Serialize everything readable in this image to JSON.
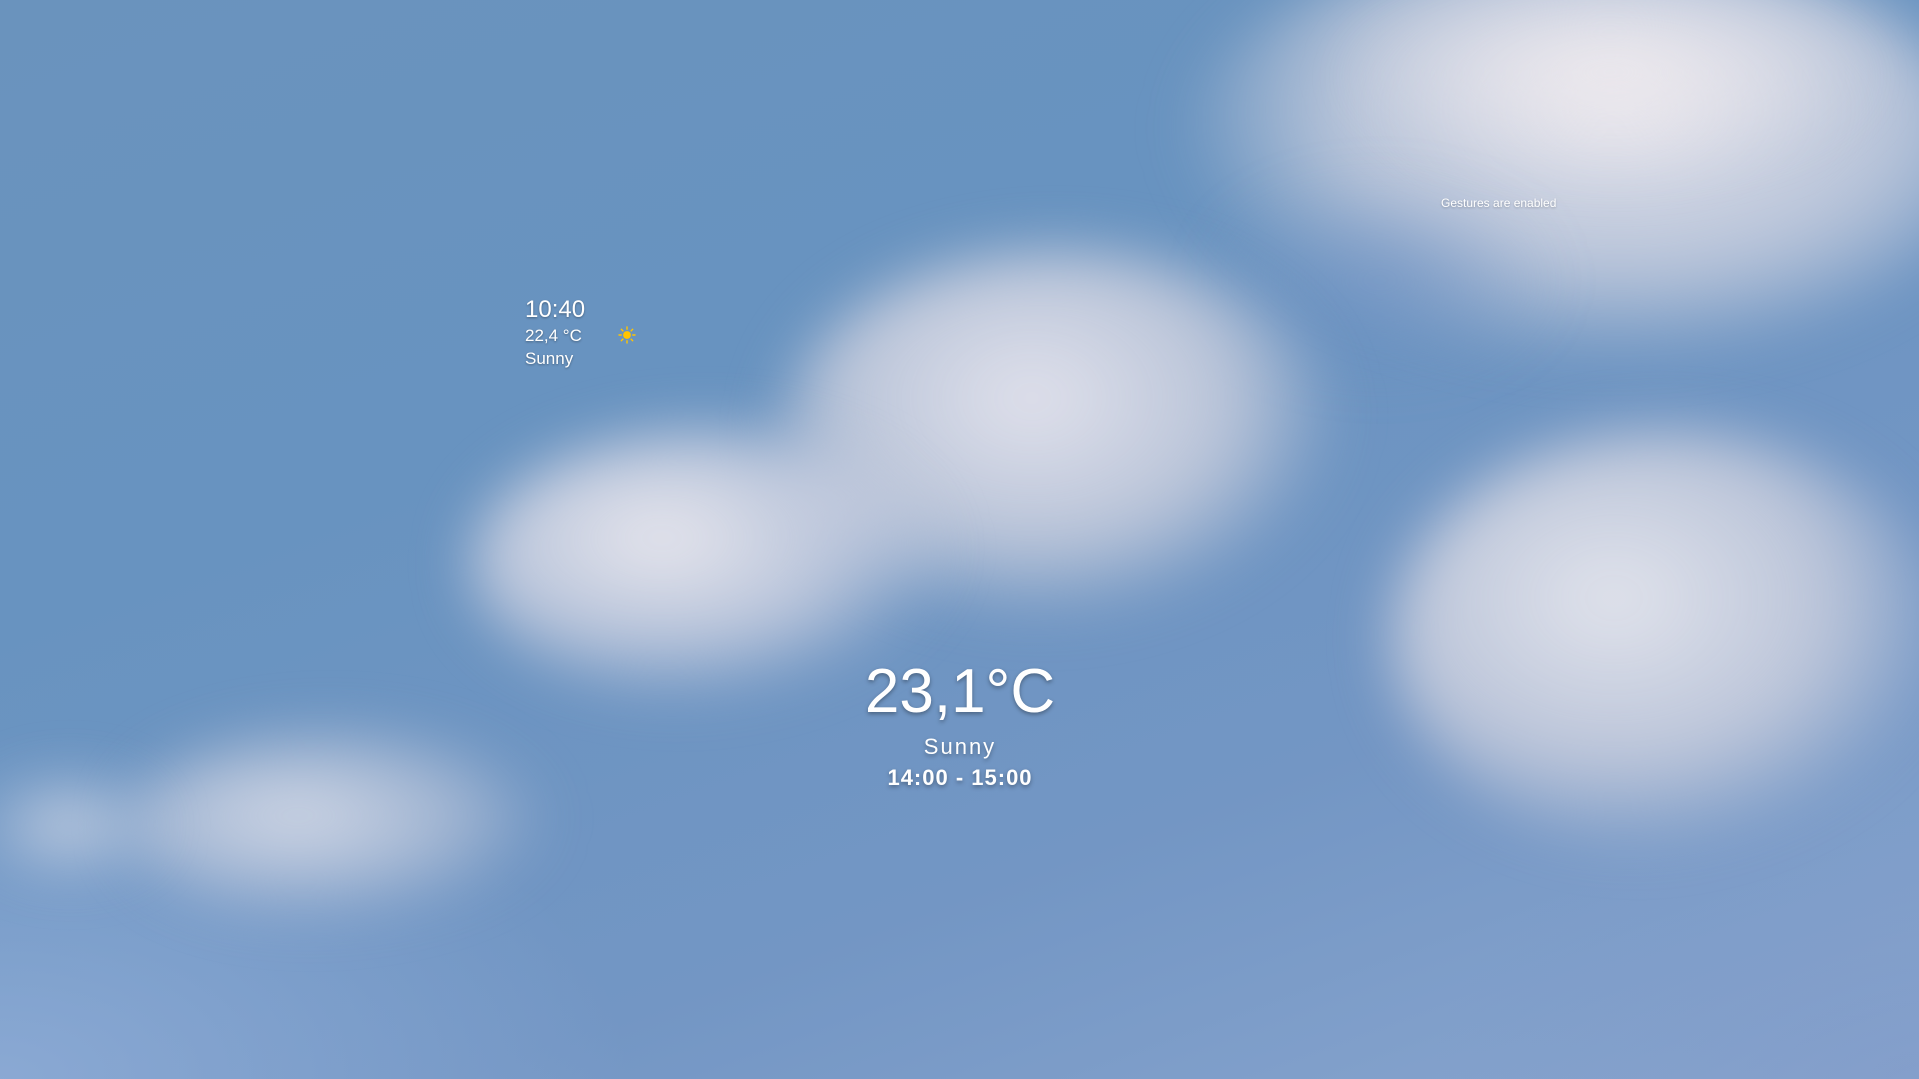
{
  "status": {
    "gestures_message": "Gestures are enabled"
  },
  "current": {
    "time": "10:40",
    "temperature": "22,4 °C",
    "condition": "Sunny",
    "icon": "sun-icon",
    "icon_color": "#FFC400"
  },
  "forecast": {
    "temperature": "23,1°C",
    "condition": "Sunny",
    "time_range": "14:00 - 15:00"
  },
  "colors": {
    "sky": "#6893C0",
    "cloud": "#E8E6EE",
    "text": "#FFFFFF"
  }
}
